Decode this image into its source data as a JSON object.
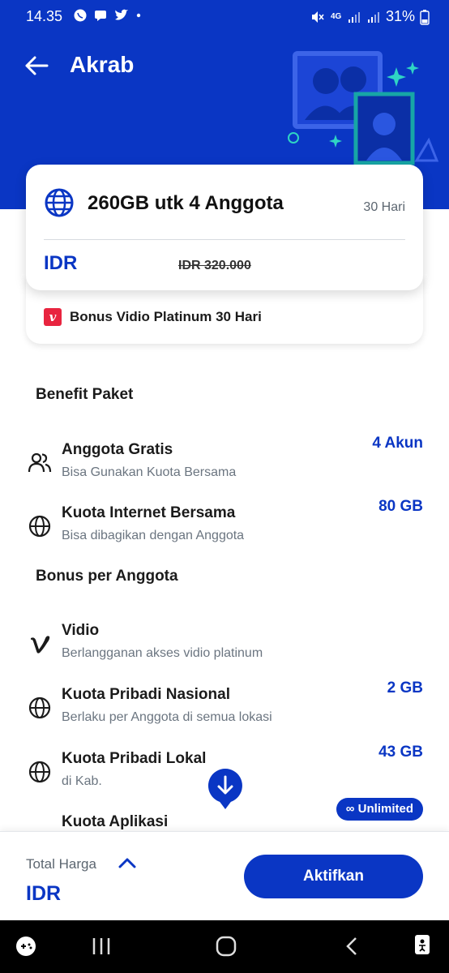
{
  "status_bar": {
    "time": "14.35",
    "battery": "31%",
    "network": "4G"
  },
  "header": {
    "title": "Akrab",
    "bg_color": "#0a36c4"
  },
  "package": {
    "title": "260GB utk 4 Anggota",
    "duration": "30 Hari",
    "currency": "IDR",
    "old_price": "IDR 320.000",
    "bonus": "Bonus Vidio Platinum 30 Hari",
    "bonus_badge": "v"
  },
  "benefit_section": {
    "title": "Benefit Paket",
    "items": [
      {
        "name": "Anggota Gratis",
        "desc": "Bisa Gunakan Kuota Bersama",
        "value": "4 Akun",
        "icon": "people-icon"
      },
      {
        "name": "Kuota Internet Bersama",
        "desc": "Bisa dibagikan dengan Anggota",
        "value": "80 GB",
        "icon": "globe-icon"
      }
    ]
  },
  "bonus_section": {
    "title": "Bonus per Anggota",
    "items": [
      {
        "name": "Vidio",
        "desc": "Berlangganan akses vidio platinum",
        "value": "",
        "icon": "vidio-icon"
      },
      {
        "name": "Kuota Pribadi Nasional",
        "desc": "Berlaku per Anggota di semua lokasi",
        "value": "2 GB",
        "icon": "globe-icon"
      },
      {
        "name": "Kuota Pribadi Lokal",
        "desc": "di Kab.",
        "value": "43 GB",
        "icon": "globe-icon"
      },
      {
        "name": "Kuota Aplikasi",
        "desc": "",
        "value": "∞ Unlimited",
        "icon": "app-icon"
      }
    ]
  },
  "bottom": {
    "total_label": "Total Harga",
    "total_value": "IDR",
    "activate_label": "Aktifkan"
  }
}
